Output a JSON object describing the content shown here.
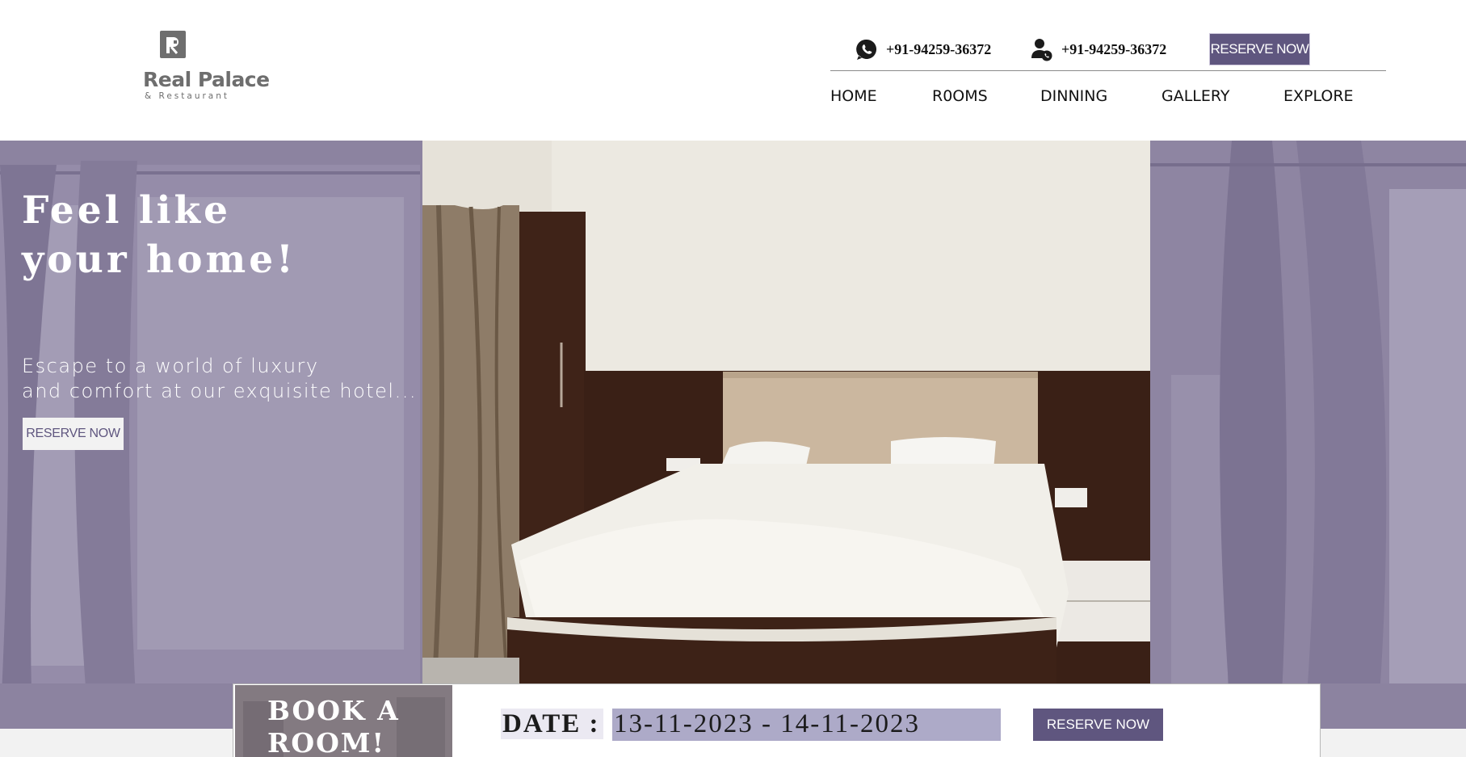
{
  "brand": {
    "name": "Real Palace",
    "subtitle": "& Restaurant"
  },
  "header": {
    "whatsapp_icon": "whatsapp-icon",
    "whatsapp_number": "+91-94259-36372",
    "call_icon": "user-call-icon",
    "call_number": "+91-94259-36372",
    "reserve_label": "RESERVE NOW"
  },
  "nav": {
    "items": [
      {
        "label": "HOME"
      },
      {
        "label": "R0OMS"
      },
      {
        "label": "DINNING"
      },
      {
        "label": "GALLERY"
      },
      {
        "label": "EXPLORE"
      }
    ]
  },
  "hero": {
    "title_line1": "Feel like",
    "title_line2": "your home!",
    "tagline_line1": "Escape to a world of luxury",
    "tagline_line2": "and comfort at our exquisite hotel...",
    "reserve_label": "RESERVE NOW"
  },
  "booking": {
    "card_line1": "BOOK A",
    "card_line2": "ROOM!",
    "date_label": "DATE :",
    "date_value": "13-11-2023 - 14-11-2023",
    "reserve_label": "RESERVE NOW"
  },
  "colors": {
    "accent": "#5f567f",
    "overlay": "#8a80a0",
    "date_field": "#adaac8"
  }
}
